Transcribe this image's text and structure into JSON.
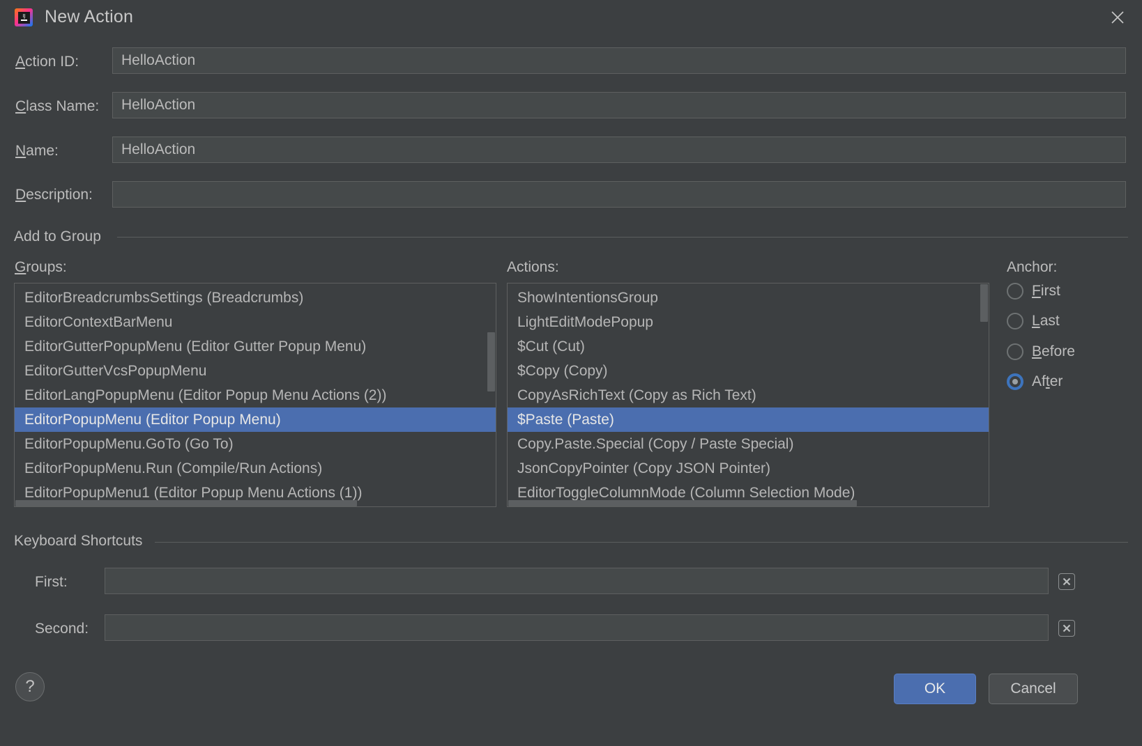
{
  "window": {
    "title": "New Action",
    "app_icon": "intellij-idea-logo-icon",
    "close_icon": "close-icon"
  },
  "colors": {
    "background": "#3c3f41",
    "field_background": "#45494a",
    "selection_blue": "#4b6eaf",
    "accent_blue": "#3d74bd",
    "border": "#5e6060",
    "text": "#bbbbbb"
  },
  "form": {
    "action_id": {
      "label_before": "A",
      "label_mnemonic": "A",
      "label": "Action ID:",
      "value": "HelloAction",
      "placeholder": ""
    },
    "class_name": {
      "label": "Class Name:",
      "value": "HelloAction",
      "placeholder": ""
    },
    "name": {
      "label": "Name:",
      "value": "HelloAction",
      "placeholder": ""
    },
    "description": {
      "label": "Description:",
      "value": "",
      "placeholder": ""
    }
  },
  "labels": {
    "action_id_pre": "",
    "action_id_mn": "A",
    "action_id_post": "ction ID:",
    "class_name_pre": "",
    "class_name_mn": "C",
    "class_name_post": "lass Name:",
    "name_pre": "",
    "name_mn": "N",
    "name_post": "ame:",
    "description_pre": "",
    "description_mn": "D",
    "description_post": "escription:"
  },
  "add_to_group": {
    "section_title": "Add to Group",
    "groups_label_mn": "G",
    "groups_label_post": "roups:",
    "actions_label": "Actions:",
    "groups": [
      {
        "text": "EditorBreadcrumbsSettings (Breadcrumbs)",
        "selected": false
      },
      {
        "text": "EditorContextBarMenu",
        "selected": false
      },
      {
        "text": "EditorGutterPopupMenu (Editor Gutter Popup Menu)",
        "selected": false
      },
      {
        "text": "EditorGutterVcsPopupMenu",
        "selected": false
      },
      {
        "text": "EditorLangPopupMenu (Editor Popup Menu Actions (2))",
        "selected": false
      },
      {
        "text": "EditorPopupMenu (Editor Popup Menu)",
        "selected": true
      },
      {
        "text": "EditorPopupMenu.GoTo (Go To)",
        "selected": false
      },
      {
        "text": "EditorPopupMenu.Run (Compile/Run Actions)",
        "selected": false
      },
      {
        "text": "EditorPopupMenu1 (Editor Popup Menu Actions (1))",
        "selected": false
      }
    ],
    "actions": [
      {
        "text": "ShowIntentionsGroup",
        "selected": false
      },
      {
        "text": "LightEditModePopup",
        "selected": false
      },
      {
        "text": "$Cut (Cut)",
        "selected": false
      },
      {
        "text": "$Copy (Copy)",
        "selected": false
      },
      {
        "text": "CopyAsRichText (Copy as Rich Text)",
        "selected": false
      },
      {
        "text": "$Paste (Paste)",
        "selected": true
      },
      {
        "text": "Copy.Paste.Special (Copy / Paste Special)",
        "selected": false
      },
      {
        "text": "JsonCopyPointer (Copy JSON Pointer)",
        "selected": false
      },
      {
        "text": "EditorToggleColumnMode (Column Selection Mode)",
        "selected": false
      }
    ]
  },
  "anchor": {
    "label": "Anchor:",
    "options": [
      {
        "mn": "F",
        "post": "irst",
        "selected": false,
        "name": "First"
      },
      {
        "mn": "L",
        "post": "ast",
        "selected": false,
        "name": "Last"
      },
      {
        "mn": "B",
        "post": "efore",
        "selected": false,
        "name": "Before"
      },
      {
        "pre": "Af",
        "mn": "t",
        "post": "er",
        "selected": true,
        "name": "After"
      }
    ]
  },
  "keyboard_shortcuts": {
    "section_title": "Keyboard Shortcuts",
    "first": {
      "label": "First:",
      "value": "",
      "placeholder": "",
      "clear_icon": "clear-x-icon"
    },
    "second": {
      "label": "Second:",
      "value": "",
      "placeholder": "",
      "clear_icon": "clear-x-icon"
    }
  },
  "footer": {
    "help_icon": "help-question-icon",
    "help_label": "?",
    "ok_label": "OK",
    "cancel_label": "Cancel"
  }
}
